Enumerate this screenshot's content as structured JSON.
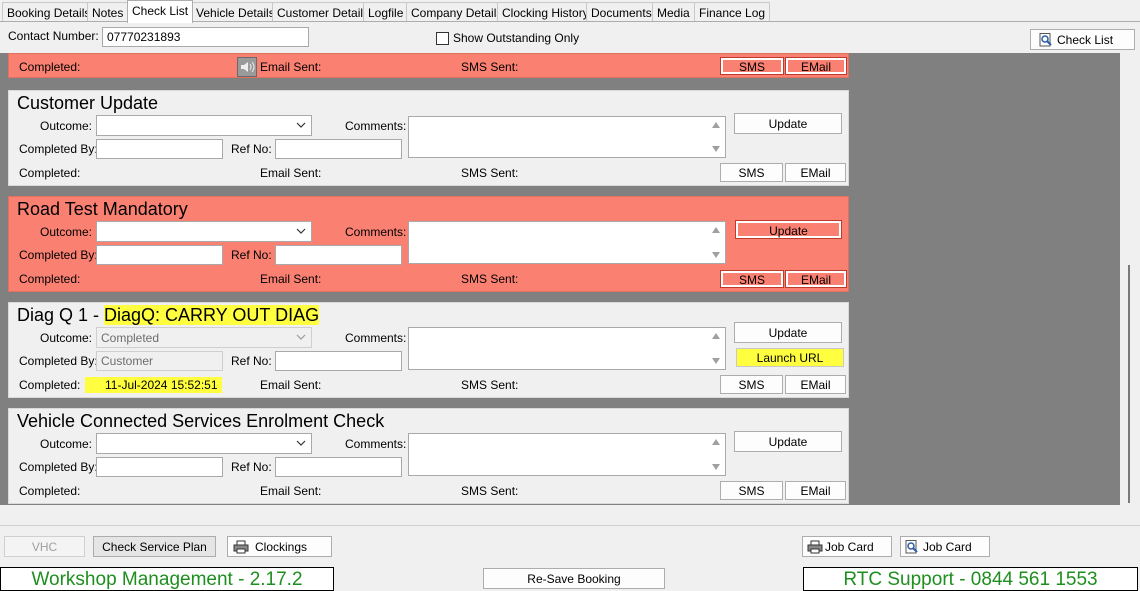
{
  "tabs": [
    "Booking Details",
    "Notes",
    "Check List",
    "Vehicle Details",
    "Customer Details",
    "Logfile",
    "Company Details",
    "Clocking History",
    "Documents",
    "Media",
    "Finance Log"
  ],
  "active_tab": "Check List",
  "header": {
    "contact_label": "Contact Number:",
    "contact_value": "07770231893",
    "show_outstanding_label": "Show Outstanding Only",
    "check_list_button": "Check List"
  },
  "labels": {
    "outcome": "Outcome:",
    "comments": "Comments:",
    "completed_by": "Completed By:",
    "ref_no": "Ref No:",
    "completed": "Completed:",
    "email_sent": "Email Sent:",
    "sms_sent": "SMS Sent:",
    "update": "Update",
    "sms": "SMS",
    "email": "EMail",
    "launch_url": "Launch URL"
  },
  "top_partial": {
    "status": "red"
  },
  "items": [
    {
      "title": "Customer Update",
      "status": "normal",
      "outcome": "",
      "completed_by": "",
      "ref_no": "",
      "completed": ""
    },
    {
      "title": "Road Test Mandatory",
      "status": "red",
      "outcome": "",
      "completed_by": "",
      "ref_no": "",
      "completed": ""
    },
    {
      "title_prefix": "Diag Q 1  - ",
      "title_highlight": "DiagQ: CARRY OUT DIAG",
      "status": "normal",
      "outcome": "Completed",
      "completed_by": "Customer",
      "ref_no": "",
      "completed": "11-Jul-2024 15:52:51"
    },
    {
      "title": "Vehicle Connected Services Enrolment Check",
      "status": "normal",
      "outcome": "",
      "completed_by": "",
      "ref_no": "",
      "completed": ""
    }
  ],
  "footer": {
    "vhc": "VHC",
    "check_service_plan": "Check Service Plan",
    "clockings": "Clockings",
    "job_card_1": "Job Card",
    "job_card_2": "Job Card",
    "resave": "Re-Save Booking",
    "app_version": "Workshop Management - 2.17.2",
    "support": "RTC Support - 0844 561 1553"
  },
  "colors": {
    "alert_red": "#fa8072",
    "grey_background": "#808080",
    "highlight": "#ffff40",
    "brand_green": "#1e8f1e"
  }
}
